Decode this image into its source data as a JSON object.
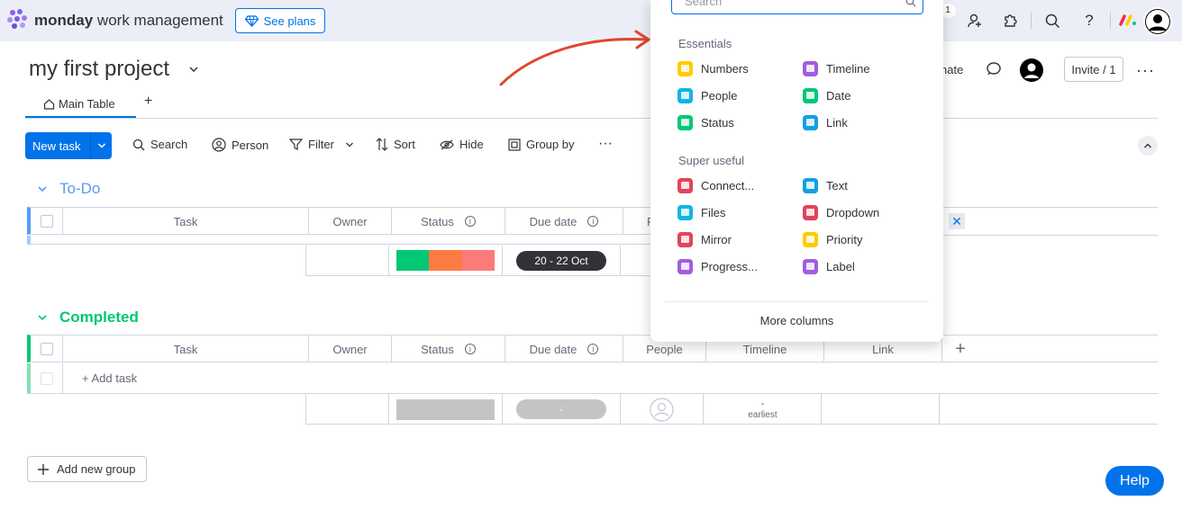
{
  "topbar": {
    "brand_bold": "monday",
    "brand_light": "work management",
    "see_plans": "See plans",
    "notification_count": "1"
  },
  "board": {
    "title": "my first project",
    "tabs": [
      {
        "label": "Main Table"
      }
    ],
    "add_tab": "+",
    "header_actions": {
      "integrate_partial": "nate",
      "invite": "Invite / 1"
    }
  },
  "toolbar": {
    "new_task": "New task",
    "search": "Search",
    "person": "Person",
    "filter": "Filter",
    "sort": "Sort",
    "hide": "Hide",
    "group_by": "Group by"
  },
  "groups": [
    {
      "name": "To-Do",
      "color": "#579bfc",
      "columns": [
        "Task",
        "Owner",
        "Status",
        "Due date",
        "Pe"
      ],
      "summary": {
        "status_colors": [
          "#00c875",
          "#fd7b43",
          "#fb7b7b"
        ],
        "due_range": "20 - 22 Oct"
      }
    },
    {
      "name": "Completed",
      "color": "#00c875",
      "columns": [
        "Task",
        "Owner",
        "Status",
        "Due date",
        "People",
        "Timeline",
        "Link"
      ],
      "add_task": "+ Add task",
      "summary": {
        "due_range": "-",
        "timeline_dash": "-",
        "timeline_note": "earliest"
      }
    }
  ],
  "add_new_group": "Add new group",
  "help": "Help",
  "column_picker": {
    "search_placeholder": "Search",
    "sections": [
      {
        "title": "Essentials",
        "items": [
          {
            "label": "Numbers",
            "color": "#ffcb00"
          },
          {
            "label": "Timeline",
            "color": "#a25ddc"
          },
          {
            "label": "People",
            "color": "#11b5e4"
          },
          {
            "label": "Date",
            "color": "#00c875"
          },
          {
            "label": "Status",
            "color": "#00c875"
          },
          {
            "label": "Link",
            "color": "#11a0e4"
          }
        ]
      },
      {
        "title": "Super useful",
        "items": [
          {
            "label": "Connect...",
            "color": "#e2445c"
          },
          {
            "label": "Text",
            "color": "#11a0e4"
          },
          {
            "label": "Files",
            "color": "#11b5e4"
          },
          {
            "label": "Dropdown",
            "color": "#e2445c"
          },
          {
            "label": "Mirror",
            "color": "#e2445c"
          },
          {
            "label": "Priority",
            "color": "#ffcb00"
          },
          {
            "label": "Progress...",
            "color": "#a25ddc"
          },
          {
            "label": "Label",
            "color": "#a25ddc"
          }
        ]
      }
    ],
    "more_columns": "More columns"
  }
}
